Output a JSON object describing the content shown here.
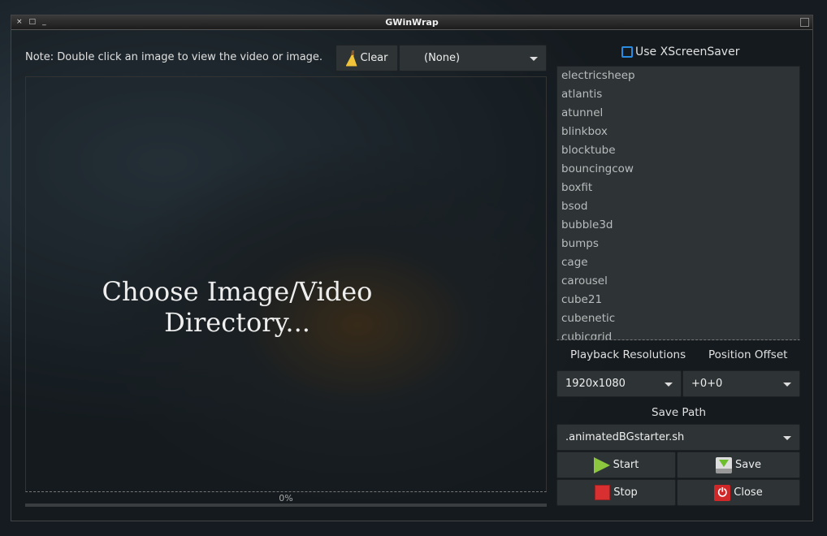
{
  "window": {
    "title": "GWinWrap",
    "controls": [
      "×",
      "□",
      "_"
    ]
  },
  "toolbar": {
    "note": "Note: Double click an image to view the video or image.",
    "clear_label": "Clear",
    "filter_value": "(None)"
  },
  "preview": {
    "placeholder": "Choose Image/Video Directory...",
    "progress_label": "0%",
    "progress_percent": 0
  },
  "sidebar": {
    "use_xscreensaver_label": "Use XScreenSaver",
    "use_xscreensaver_checked": false,
    "screensavers": [
      "electricsheep",
      "atlantis",
      "atunnel",
      "blinkbox",
      "blocktube",
      "bouncingcow",
      "boxfit",
      "bsod",
      "bubble3d",
      "bumps",
      "cage",
      "carousel",
      "cube21",
      "cubenetic",
      "cubicgrid"
    ],
    "playback_label": "Playback Resolutions",
    "offset_label": "Position Offset",
    "resolution_value": "1920x1080",
    "offset_value": "+0+0",
    "save_path_label": "Save Path",
    "save_path_value": ".animatedBGstarter.sh",
    "start_label": "Start",
    "save_label": "Save",
    "stop_label": "Stop",
    "close_label": "Close"
  },
  "colors": {
    "accent": "#2a8ce0",
    "button_bg": "#2e3436"
  }
}
